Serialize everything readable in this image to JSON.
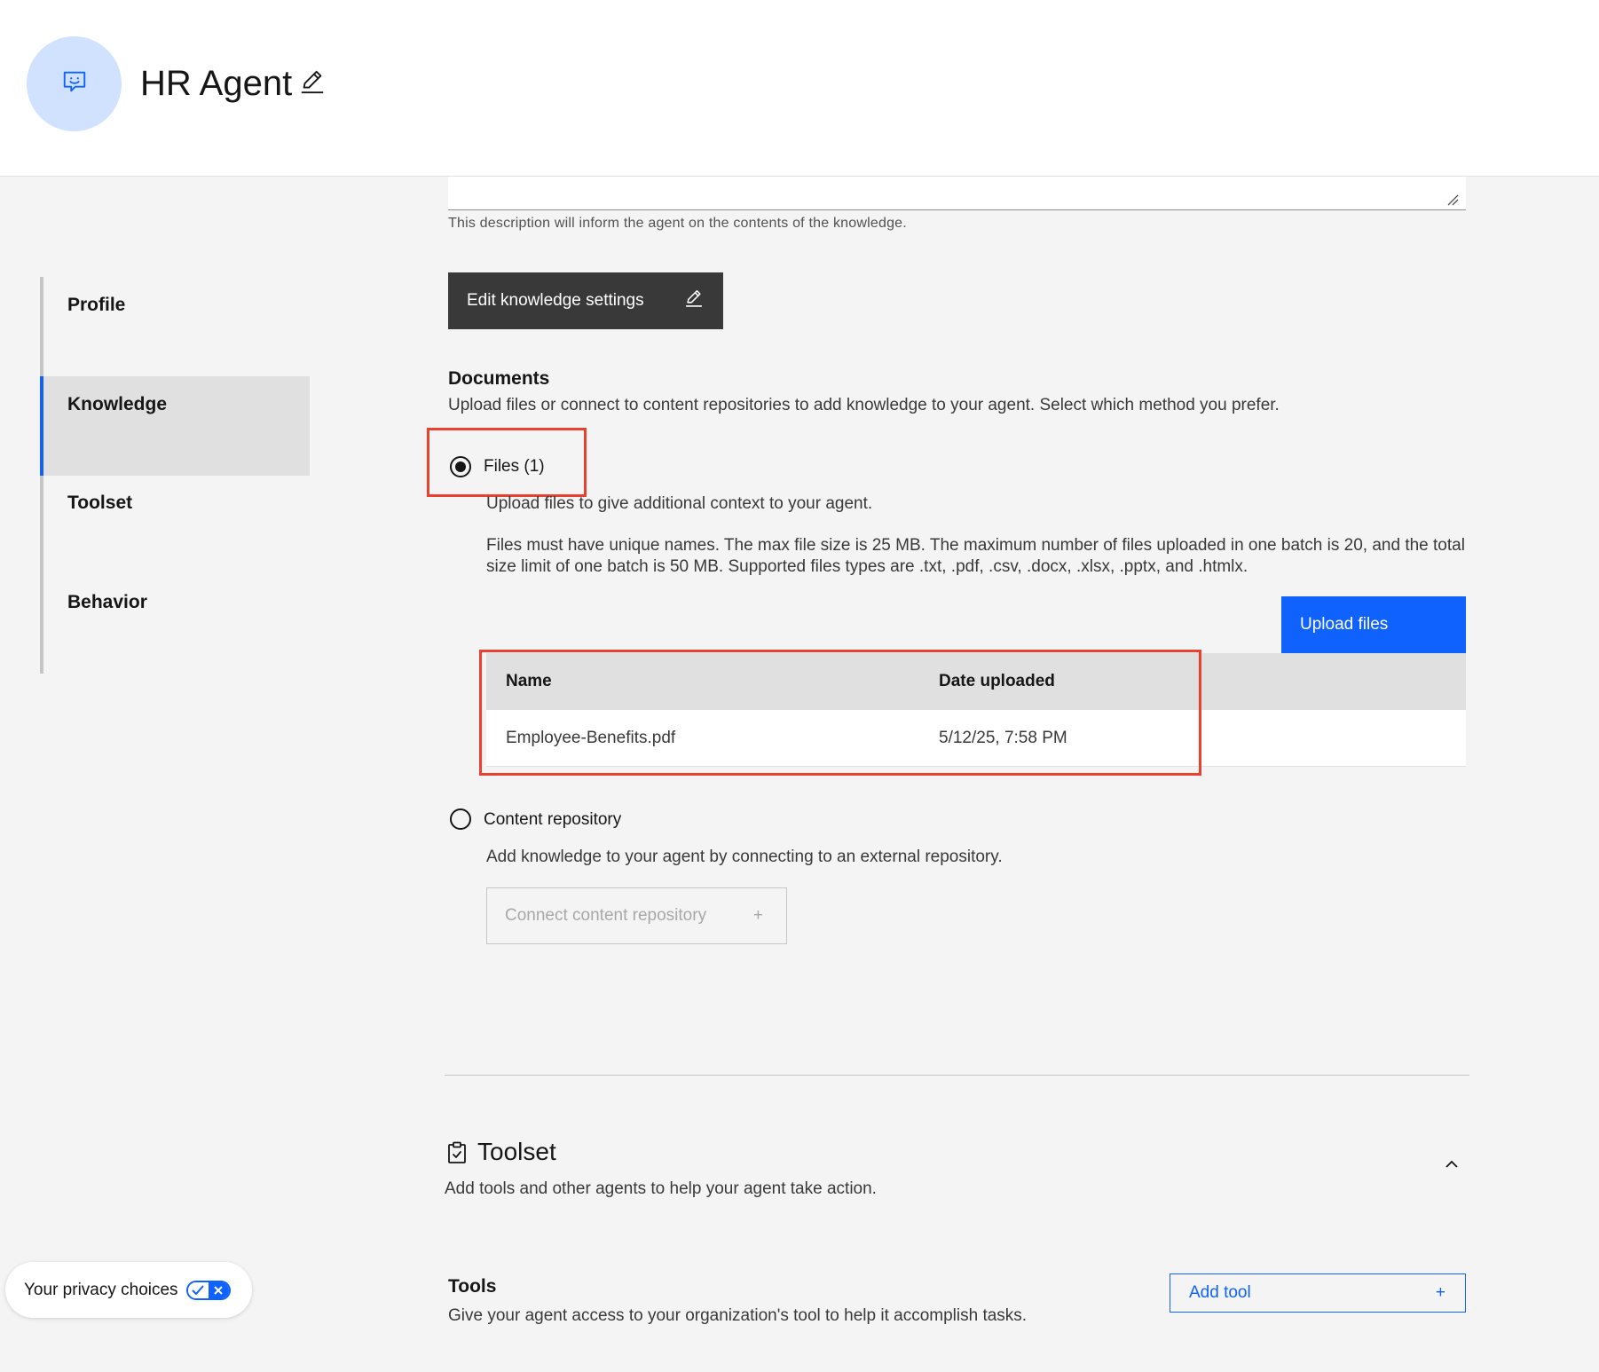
{
  "header": {
    "agent_name": "HR Agent",
    "icons": {
      "avatar": "chat-bot-icon",
      "edit": "pencil-icon"
    }
  },
  "sidebar": {
    "items": [
      {
        "label": "Profile",
        "active": false
      },
      {
        "label": "Knowledge",
        "active": true
      },
      {
        "label": "Toolset",
        "active": false
      },
      {
        "label": "Behavior",
        "active": false
      }
    ],
    "accent_color": "#0f62fe"
  },
  "knowledge": {
    "description_value": "",
    "description_helper": "This description will inform the agent on the contents of the knowledge.",
    "edit_settings_label": "Edit knowledge settings",
    "documents": {
      "heading": "Documents",
      "description": "Upload files or connect to content repositories to add knowledge to your agent. Select which method you prefer.",
      "files_option": {
        "label": "Files (1)",
        "selected": true,
        "description": "Upload files to give additional context to your agent.",
        "rules": "Files must have unique names. The max file size is 25 MB. The maximum number of files uploaded in one batch is 20, and the total size limit of one batch is 50 MB. Supported files types are .txt, .pdf, .csv, .docx, .xlsx, .pptx, and .htmlx.",
        "upload_label": "Upload files"
      },
      "table": {
        "columns": [
          "Name",
          "Date uploaded"
        ],
        "rows": [
          {
            "name": "Employee-Benefits.pdf",
            "date": "5/12/25, 7:58 PM"
          }
        ]
      },
      "repository_option": {
        "label": "Content repository",
        "selected": false,
        "description": "Add knowledge to your agent by connecting to an external repository.",
        "connect_label": "Connect content repository",
        "connect_icon": "+"
      }
    }
  },
  "toolset": {
    "heading": "Toolset",
    "description": "Add tools and other agents to help your agent take action.",
    "tools": {
      "heading": "Tools",
      "description": "Give your agent access to your organization's tool to help it accomplish tasks.",
      "add_label": "Add tool",
      "add_icon": "+"
    }
  },
  "privacy": {
    "label": "Your privacy choices"
  },
  "highlight_color": "#e8412f"
}
